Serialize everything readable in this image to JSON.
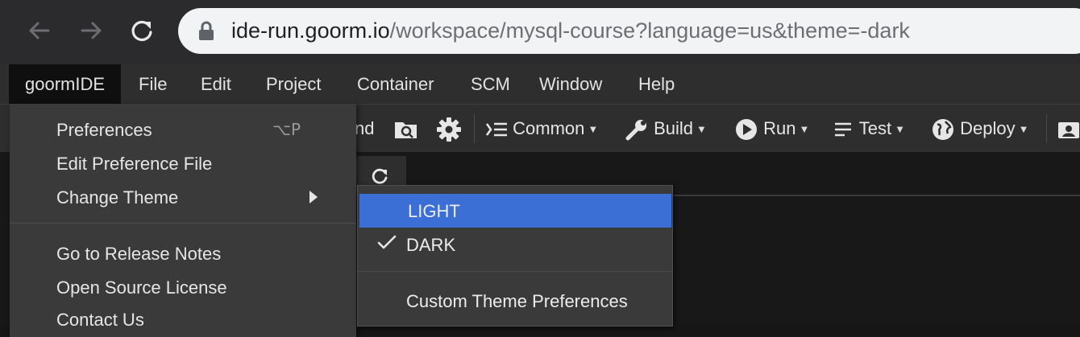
{
  "browser": {
    "url_host": "ide-run.goorm.io",
    "url_path": "/workspace/mysql-course?language=us&theme=-dark"
  },
  "menubar": {
    "items": [
      "goormIDE",
      "File",
      "Edit",
      "Project",
      "Container",
      "SCM",
      "Window",
      "Help"
    ]
  },
  "toolbar": {
    "partial_label": "nd",
    "common_label": "Common",
    "build_label": "Build",
    "run_label": "Run",
    "test_label": "Test",
    "deploy_label": "Deploy"
  },
  "goorm_menu": {
    "preferences": "Preferences",
    "preferences_shortcut": "⌥P",
    "edit_pref_file": "Edit Preference File",
    "change_theme": "Change Theme",
    "release_notes": "Go to Release Notes",
    "open_source": "Open Source License",
    "contact": "Contact Us"
  },
  "theme_menu": {
    "light": "LIGHT",
    "dark": "DARK",
    "custom": "Custom Theme Preferences"
  },
  "colors": {
    "highlight": "#3c6fd6",
    "menu_bg": "#3a3a3a",
    "bar_bg": "#2e2e2e"
  }
}
